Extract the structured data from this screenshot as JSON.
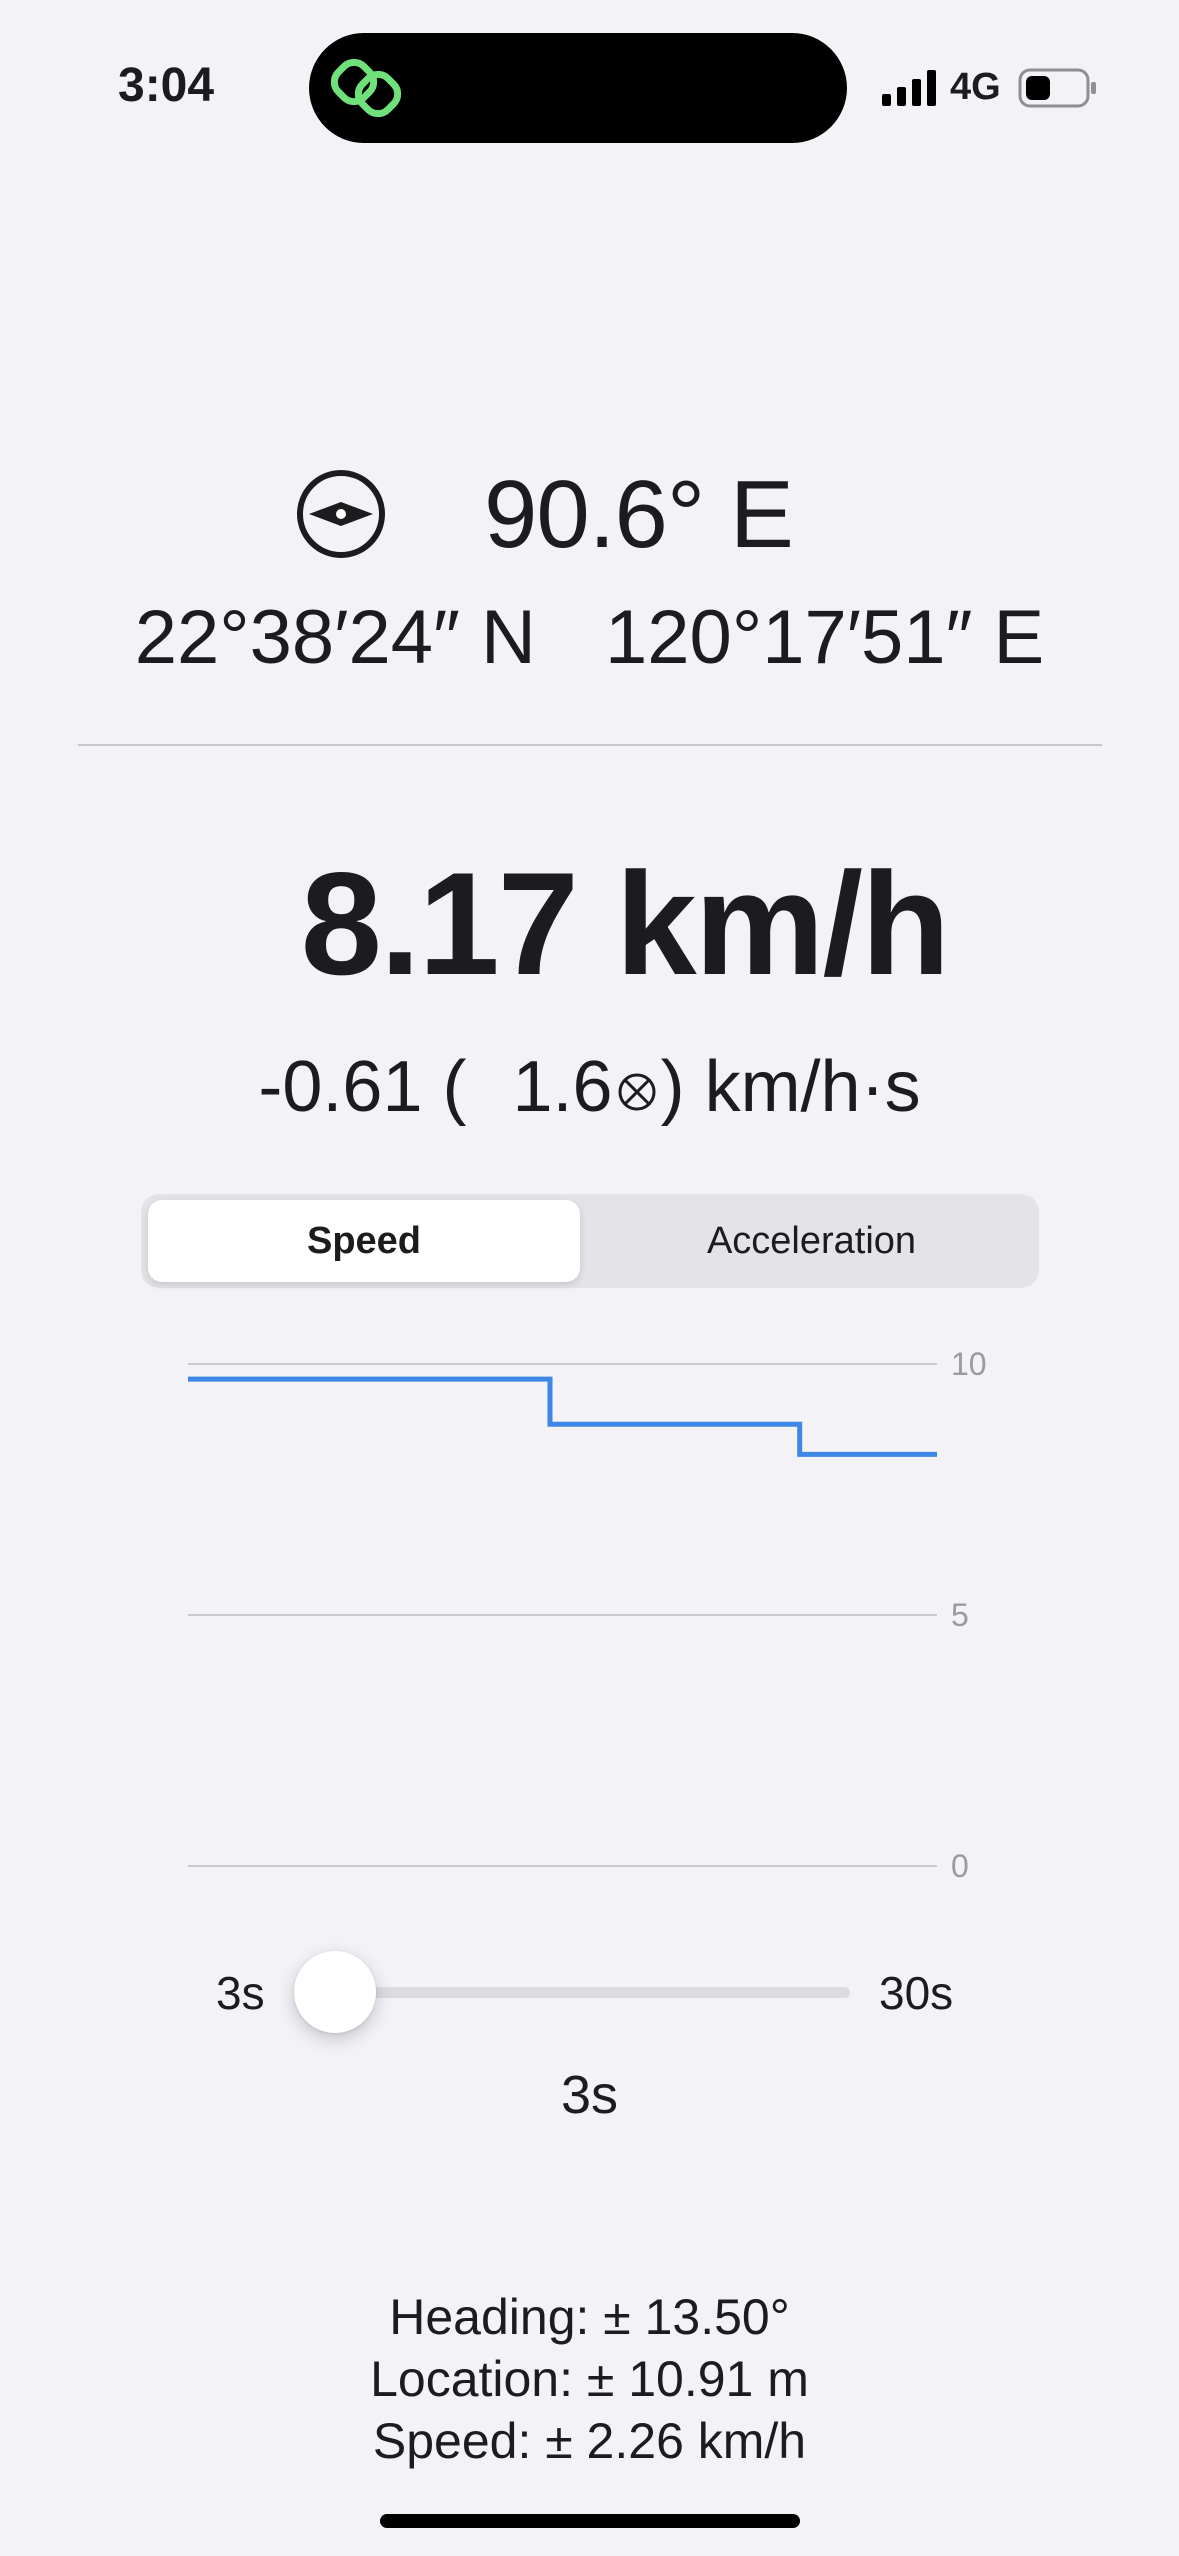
{
  "status_bar": {
    "time": "3:04",
    "network": "4G",
    "icons": [
      "link-icon",
      "signal-icon",
      "battery-icon"
    ],
    "accent": "#6fe07a"
  },
  "heading": {
    "icon": "compass-icon",
    "value": "90.6° E",
    "latitude": "22°38′24″ N",
    "longitude": "120°17′51″ E"
  },
  "speed": {
    "value": "8.17 km/h",
    "accel_value": "-0.61 (",
    "accel_value2": "1.6",
    "accel_unit": ") km/h·s"
  },
  "segmented": {
    "options": [
      "Speed",
      "Acceleration"
    ],
    "selected": "Speed"
  },
  "chart_data": {
    "type": "line",
    "step": true,
    "color": "#3f87e6",
    "ylim": [
      0,
      10
    ],
    "yticks": [
      "10",
      "5",
      "0"
    ],
    "yaxis_position": "right",
    "grid": true,
    "x": [
      0,
      1.45,
      1.45,
      2.45,
      2.45,
      3
    ],
    "y": [
      9.7,
      9.7,
      8.8,
      8.8,
      8.2,
      8.2
    ]
  },
  "slider": {
    "min_label": "3s",
    "max_label": "30s",
    "value_label": "3s",
    "value_fraction": 0
  },
  "accuracy": {
    "heading": "Heading:  ± 13.50°",
    "location": "Location:  ± 10.91 m",
    "speed": "Speed:  ± 2.26 km/h"
  }
}
